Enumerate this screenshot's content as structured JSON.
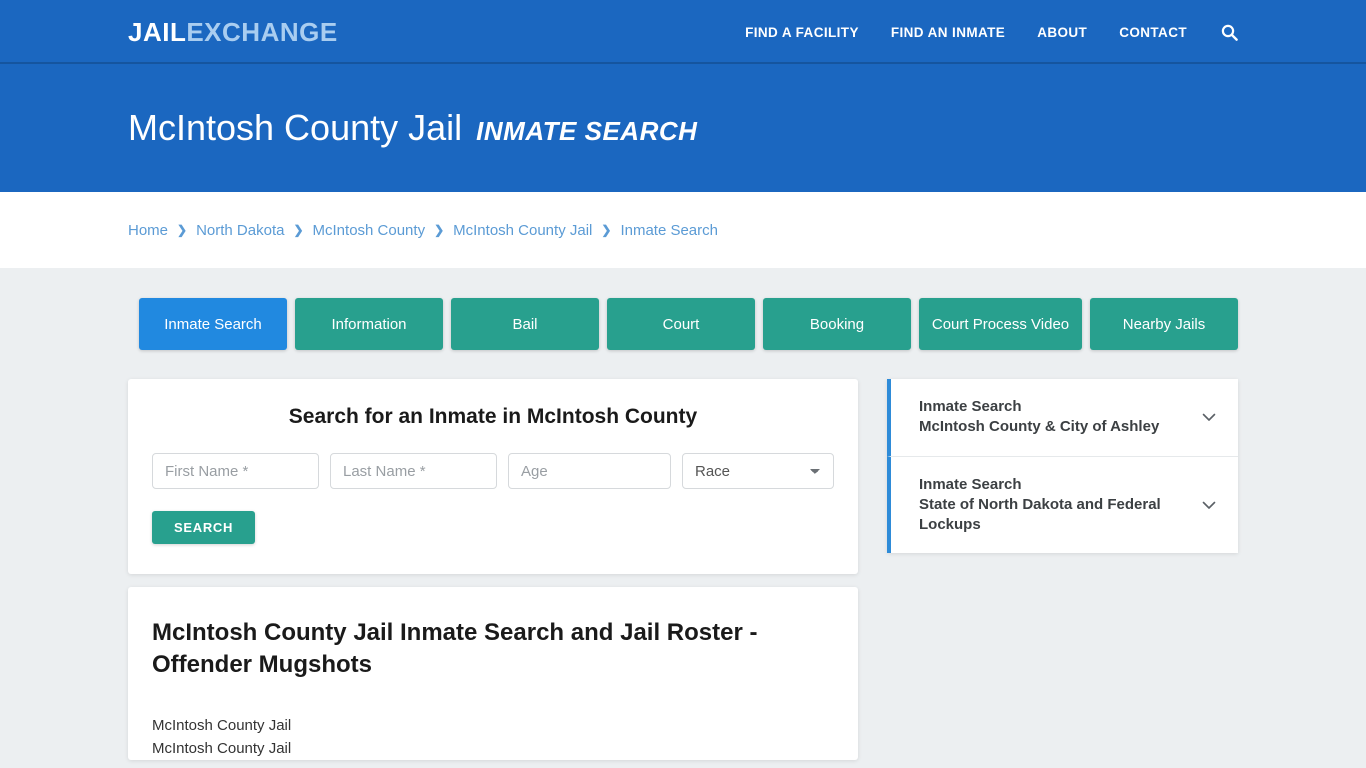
{
  "header": {
    "logo_primary": "JAIL",
    "logo_secondary": "EXCHANGE",
    "nav": [
      {
        "label": "FIND A FACILITY"
      },
      {
        "label": "FIND AN INMATE"
      },
      {
        "label": "ABOUT"
      },
      {
        "label": "CONTACT"
      }
    ],
    "search_icon": "search-icon"
  },
  "hero": {
    "title": "McIntosh County Jail",
    "subtitle": "INMATE SEARCH"
  },
  "breadcrumb": {
    "separator": "❯",
    "items": [
      {
        "label": "Home"
      },
      {
        "label": "North Dakota"
      },
      {
        "label": "McIntosh County"
      },
      {
        "label": "McIntosh County Jail"
      },
      {
        "label": "Inmate Search"
      }
    ]
  },
  "tabs": [
    {
      "label": "Inmate Search",
      "active": true
    },
    {
      "label": "Information",
      "active": false
    },
    {
      "label": "Bail",
      "active": false
    },
    {
      "label": "Court",
      "active": false
    },
    {
      "label": "Booking",
      "active": false
    },
    {
      "label": "Court Process Video",
      "active": false
    },
    {
      "label": "Nearby Jails",
      "active": false
    }
  ],
  "search_form": {
    "heading": "Search for an Inmate in McIntosh County",
    "first_name_placeholder": "First Name *",
    "first_name_value": "",
    "last_name_placeholder": "Last Name *",
    "last_name_value": "",
    "age_placeholder": "Age",
    "age_value": "",
    "race_selected": "Race",
    "submit_label": "SEARCH"
  },
  "article": {
    "title": "McIntosh County Jail Inmate Search and Jail Roster - Offender Mugshots",
    "line1": "McIntosh County Jail",
    "line2": "McIntosh County Jail"
  },
  "sidebar": {
    "accordions": [
      {
        "line1": "Inmate Search",
        "line2": "McIntosh County & City of Ashley",
        "icon": "chevron-down-icon"
      },
      {
        "line1": "Inmate Search",
        "line2": "State of North Dakota and Federal Lockups",
        "icon": "chevron-down-icon"
      }
    ]
  },
  "colors": {
    "header_blue": "#1b67c0",
    "active_tab_blue": "#2189e0",
    "tab_teal": "#28a08e",
    "accent_blue": "#2e8bd8",
    "page_bg": "#eceff1",
    "breadcrumb_link": "#5b9bd5",
    "logo_secondary": "#a9cdf0"
  }
}
